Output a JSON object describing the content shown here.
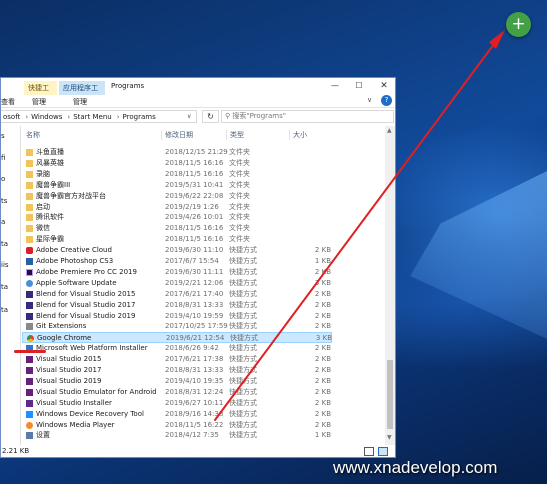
{
  "explorer": {
    "title": "Programs",
    "ribbon_tabs": [
      "快捷工具",
      "应用程序工具"
    ],
    "ribbon_row": [
      "查看",
      "管理",
      "管理"
    ],
    "address": [
      "osoft",
      "Windows",
      "Start Menu",
      "Programs"
    ],
    "search_placeholder": "搜索\"Programs\"",
    "columns": {
      "name": "名称",
      "date": "修改日期",
      "type": "类型",
      "size": "大小"
    },
    "nav_items": [
      "s",
      "fi",
      "o",
      "ts",
      "a",
      "ta",
      "iis",
      "ta",
      "ta"
    ],
    "files": [
      {
        "name": "斗鱼直播",
        "date": "2018/12/15 21:29",
        "type": "文件夹",
        "size": "",
        "icon": "folder-icon"
      },
      {
        "name": "风暴英雄",
        "date": "2018/11/5 16:16",
        "type": "文件夹",
        "size": "",
        "icon": "folder-icon"
      },
      {
        "name": "录脑",
        "date": "2018/11/5 16:16",
        "type": "文件夹",
        "size": "",
        "icon": "folder-icon"
      },
      {
        "name": "魔兽争霸III",
        "date": "2019/5/31 10:41",
        "type": "文件夹",
        "size": "",
        "icon": "folder-icon"
      },
      {
        "name": "魔兽争霸官方对战平台",
        "date": "2019/6/22 22:08",
        "type": "文件夹",
        "size": "",
        "icon": "folder-icon"
      },
      {
        "name": "启动",
        "date": "2019/2/19 1:26",
        "type": "文件夹",
        "size": "",
        "icon": "folder-icon"
      },
      {
        "name": "腾讯软件",
        "date": "2019/4/26 10:01",
        "type": "文件夹",
        "size": "",
        "icon": "folder-icon"
      },
      {
        "name": "微信",
        "date": "2018/11/5 16:16",
        "type": "文件夹",
        "size": "",
        "icon": "folder-icon"
      },
      {
        "name": "星际争霸",
        "date": "2018/11/5 16:16",
        "type": "文件夹",
        "size": "",
        "icon": "folder-icon"
      },
      {
        "name": "Adobe Creative Cloud",
        "date": "2019/6/30 11:10",
        "type": "快捷方式",
        "size": "2 KB",
        "icon": "creative-cloud-icon"
      },
      {
        "name": "Adobe Photoshop CS3",
        "date": "2017/6/7 15:54",
        "type": "快捷方式",
        "size": "1 KB",
        "icon": "photoshop-icon"
      },
      {
        "name": "Adobe Premiere Pro CC 2019",
        "date": "2019/6/30 11:11",
        "type": "快捷方式",
        "size": "2 KB",
        "icon": "premiere-icon"
      },
      {
        "name": "Apple Software Update",
        "date": "2019/2/21 12:06",
        "type": "快捷方式",
        "size": "3 KB",
        "icon": "apple-update-icon"
      },
      {
        "name": "Blend for Visual Studio 2015",
        "date": "2017/6/21 17:40",
        "type": "快捷方式",
        "size": "2 KB",
        "icon": "blend-icon"
      },
      {
        "name": "Blend for Visual Studio 2017",
        "date": "2018/8/31 13:33",
        "type": "快捷方式",
        "size": "2 KB",
        "icon": "blend-icon"
      },
      {
        "name": "Blend for Visual Studio 2019",
        "date": "2019/4/10 19:59",
        "type": "快捷方式",
        "size": "2 KB",
        "icon": "blend-icon"
      },
      {
        "name": "Git Extensions",
        "date": "2017/10/25 17:59",
        "type": "快捷方式",
        "size": "2 KB",
        "icon": "git-extensions-icon"
      },
      {
        "name": "Google Chrome",
        "date": "2019/6/21 12:54",
        "type": "快捷方式",
        "size": "3 KB",
        "icon": "chrome-icon",
        "selected": true
      },
      {
        "name": "Microsoft Web Platform Installer",
        "date": "2018/6/26 9:42",
        "type": "快捷方式",
        "size": "2 KB",
        "icon": "web-platform-icon"
      },
      {
        "name": "Visual Studio 2015",
        "date": "2017/6/21 17:38",
        "type": "快捷方式",
        "size": "2 KB",
        "icon": "visual-studio-icon"
      },
      {
        "name": "Visual Studio 2017",
        "date": "2018/8/31 13:33",
        "type": "快捷方式",
        "size": "2 KB",
        "icon": "visual-studio-icon"
      },
      {
        "name": "Visual Studio 2019",
        "date": "2019/4/10 19:35",
        "type": "快捷方式",
        "size": "2 KB",
        "icon": "visual-studio-icon"
      },
      {
        "name": "Visual Studio Emulator for Android",
        "date": "2018/8/31 12:24",
        "type": "快捷方式",
        "size": "2 KB",
        "icon": "emulator-icon"
      },
      {
        "name": "Visual Studio Installer",
        "date": "2019/6/27 10:11",
        "type": "快捷方式",
        "size": "2 KB",
        "icon": "vs-installer-icon"
      },
      {
        "name": "Windows Device Recovery Tool",
        "date": "2018/9/16 14:38",
        "type": "快捷方式",
        "size": "2 KB",
        "icon": "recovery-tool-icon"
      },
      {
        "name": "Windows Media Player",
        "date": "2018/11/5 16:22",
        "type": "快捷方式",
        "size": "2 KB",
        "icon": "media-player-icon"
      },
      {
        "name": "设置",
        "date": "2018/4/12 7:35",
        "type": "快捷方式",
        "size": "1 KB",
        "icon": "settings-icon"
      }
    ],
    "status_text": "2.21 KB"
  },
  "fab_label": "+",
  "watermark": "www.xnadevelop.com",
  "colors": {
    "accent": "#1e6ec8",
    "selection": "#cce8ff",
    "arrow": "#e02020",
    "fab": "#43a047"
  }
}
